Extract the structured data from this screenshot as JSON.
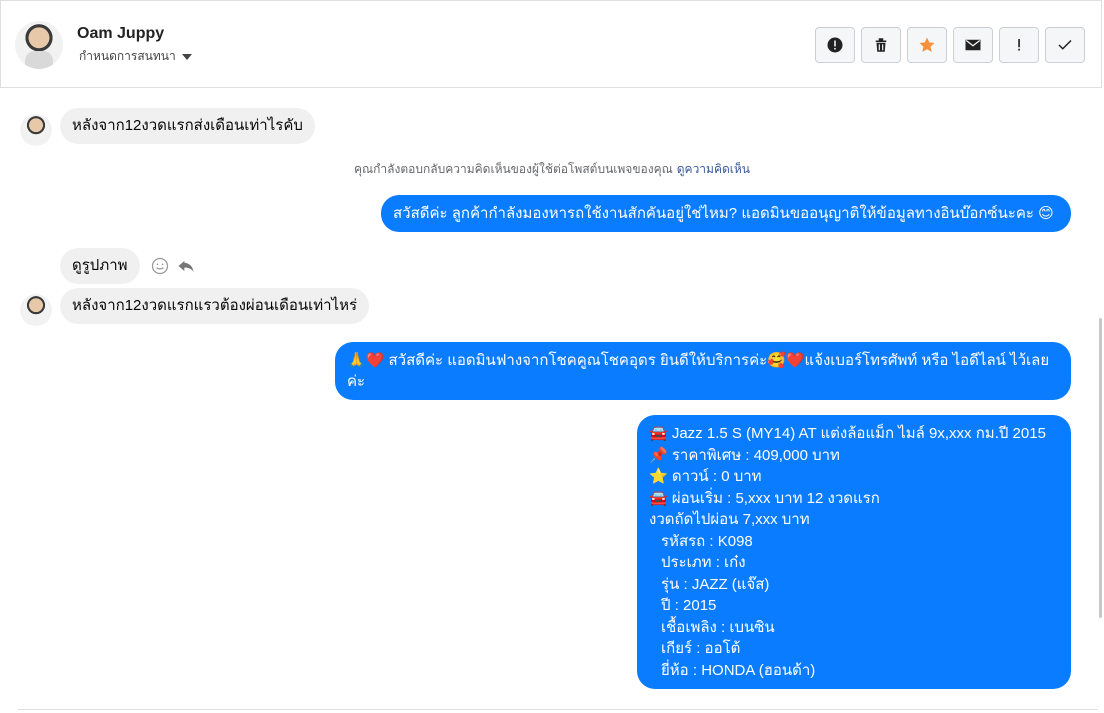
{
  "header": {
    "name": "Oam Juppy",
    "subtitle": "กำหนดการสนทนา",
    "buttons": [
      {
        "icon": "alert-circle-icon"
      },
      {
        "icon": "trash-icon"
      },
      {
        "icon": "star-icon",
        "color": "#f7923b"
      },
      {
        "icon": "mail-icon"
      },
      {
        "icon": "exclamation-icon"
      },
      {
        "icon": "check-icon"
      }
    ]
  },
  "messages": {
    "m1": "หลังจาก12งวดแรกส่งเดือนเท่าไรคับ",
    "notice": "คุณกำลังตอบกลับความคิดเห็นของผู้ใช้ต่อโพสต์บนเพจของคุณ",
    "notice_link": "ดูความคิดเห็น",
    "m2": "สวัสดีค่ะ ลูกค้ากำลังมองหารถใช้งานสักคันอยู่ใช่ไหม? แอดมินขออนุญาติให้ข้อมูลทางอินบ๊อกซ์นะคะ 😊",
    "m3": "ดูรูปภาพ",
    "m4": "หลังจาก12งวดแรกแรวต้องผ่อนเดือนเท่าไหร่",
    "m5_line1": "🙏❤️ สวัสดีค่ะ แอดมินฟางจากโชคคูณโชคอุดร ยินดีให้บริการค่ะ🥰❤️แจ้งเบอร์โทรศัพท์ หรือ ไอดีไลน์  ไว้เลย",
    "m5_line2": "ค่ะ",
    "details": [
      "🚘 Jazz 1.5 S (MY14) AT แต่งล้อแม็ก ไมล์ 9x,xxx กม.ปี 2015",
      "📌 ราคาพิเศษ : 409,000 บาท",
      "⭐ ดาวน์ : 0 บาท",
      "🚘 ผ่อนเริ่ม : 5,xxx บาท 12 งวดแรก",
      "งวดถัดไปผ่อน  7,xxx บาท"
    ],
    "specs": [
      "รหัสรถ : K098",
      "ประเภท : เก๋ง",
      "รุ่น : JAZZ (แจ๊ส)",
      "ปี : 2015",
      "เชื้อเพลิง : เบนซิน",
      "เกียร์ : ออโต้",
      "ยี่ห้อ : HONDA (ฮอนด้า)"
    ]
  },
  "colors": {
    "outgoing": "#0a7cff",
    "incoming": "#f0f0f0",
    "accent_star": "#f7923b"
  }
}
